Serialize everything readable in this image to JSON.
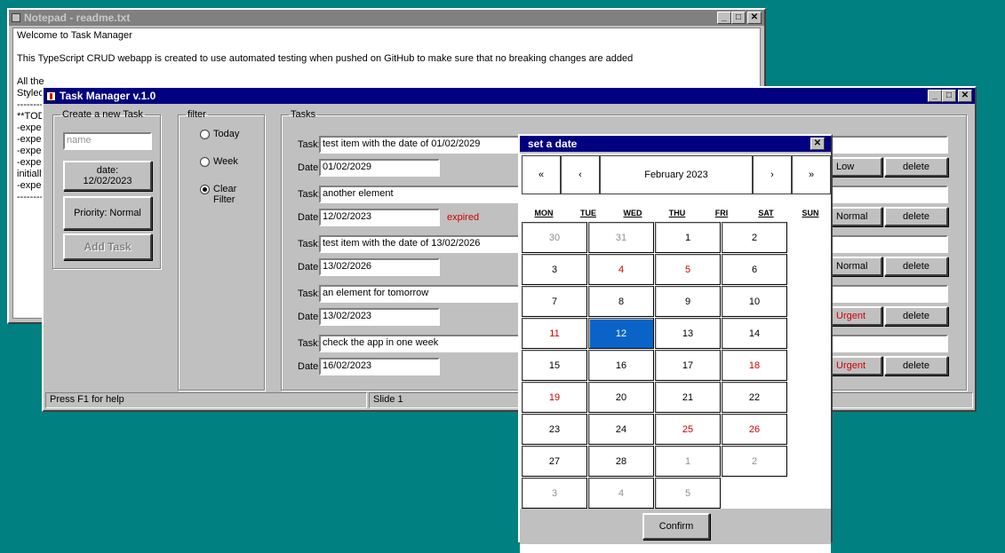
{
  "notepad": {
    "title": "Notepad - readme.txt",
    "lines": [
      "Welcome to Task Manager",
      "",
      "This TypeScript CRUD webapp is created to use automated testing when pushed on GitHub to make sure that no breaking changes are added",
      "",
      "All the",
      "Styled",
      "----------",
      "**TODO",
      "-expec",
      "-expec",
      "-expec",
      "-expec",
      "initially",
      "-expec",
      "----------"
    ]
  },
  "app": {
    "title": "Task Manager v.1.0",
    "create": {
      "legend": "Create a new Task",
      "name_placeholder": "name",
      "date_label": "date:",
      "date_value": "12/02/2023",
      "priority_label": "Priority: Normal",
      "add_label": "Add Task"
    },
    "filter": {
      "legend": "filter",
      "options": [
        {
          "label": "Today",
          "selected": false
        },
        {
          "label": "Week",
          "selected": false
        },
        {
          "label": "Clear Filter",
          "selected": true
        }
      ]
    },
    "tasks": {
      "legend": "Tasks",
      "task_label": "Task:",
      "date_label": "Date:",
      "delete_label": "delete",
      "items": [
        {
          "name": "test item with the date of 01/02/2029",
          "date": "01/02/2029",
          "status": "",
          "priority": "Low",
          "priority_red": false
        },
        {
          "name": "another element",
          "date": "12/02/2023",
          "status": "expired",
          "priority": "Normal",
          "priority_red": false
        },
        {
          "name": "test item with the date of 13/02/2026",
          "date": "13/02/2026",
          "status": "",
          "priority": "Normal",
          "priority_red": false
        },
        {
          "name": "an element for tomorrow",
          "date": "13/02/2023",
          "status": "",
          "priority": "Urgent",
          "priority_red": true
        },
        {
          "name": "check the app in one week",
          "date": "16/02/2023",
          "status": "",
          "priority": "Urgent",
          "priority_red": true
        }
      ]
    },
    "status": {
      "help": "Press F1 for help",
      "slide": "Slide 1"
    }
  },
  "datepicker": {
    "title": "set a date",
    "nav": {
      "prev_year": "«",
      "prev_month": "‹",
      "month": "February 2023",
      "next_month": "›",
      "next_year": "»"
    },
    "weekdays": [
      "MON",
      "TUE",
      "WED",
      "THU",
      "FRI",
      "SAT",
      "SUN"
    ],
    "days": [
      {
        "d": "30",
        "kind": "muted"
      },
      {
        "d": "31",
        "kind": "muted"
      },
      {
        "d": "1",
        "kind": ""
      },
      {
        "d": "2",
        "kind": ""
      },
      {
        "d": "3",
        "kind": ""
      },
      {
        "d": "4",
        "kind": "weekend"
      },
      {
        "d": "5",
        "kind": "weekend"
      },
      {
        "d": "6",
        "kind": ""
      },
      {
        "d": "7",
        "kind": ""
      },
      {
        "d": "8",
        "kind": ""
      },
      {
        "d": "9",
        "kind": ""
      },
      {
        "d": "10",
        "kind": ""
      },
      {
        "d": "11",
        "kind": "weekend"
      },
      {
        "d": "12",
        "kind": "sel"
      },
      {
        "d": "13",
        "kind": ""
      },
      {
        "d": "14",
        "kind": ""
      },
      {
        "d": "15",
        "kind": ""
      },
      {
        "d": "16",
        "kind": ""
      },
      {
        "d": "17",
        "kind": ""
      },
      {
        "d": "18",
        "kind": "weekend"
      },
      {
        "d": "19",
        "kind": "weekend"
      },
      {
        "d": "20",
        "kind": ""
      },
      {
        "d": "21",
        "kind": ""
      },
      {
        "d": "22",
        "kind": ""
      },
      {
        "d": "23",
        "kind": ""
      },
      {
        "d": "24",
        "kind": ""
      },
      {
        "d": "25",
        "kind": "weekend"
      },
      {
        "d": "26",
        "kind": "weekend"
      },
      {
        "d": "27",
        "kind": ""
      },
      {
        "d": "28",
        "kind": ""
      },
      {
        "d": "1",
        "kind": "muted"
      },
      {
        "d": "2",
        "kind": "muted"
      },
      {
        "d": "3",
        "kind": "muted"
      },
      {
        "d": "4",
        "kind": "muted"
      },
      {
        "d": "5",
        "kind": "muted"
      }
    ],
    "confirm_label": "Confirm"
  },
  "window_buttons": {
    "minimize": "_",
    "maximize": "□",
    "close": "✕"
  }
}
